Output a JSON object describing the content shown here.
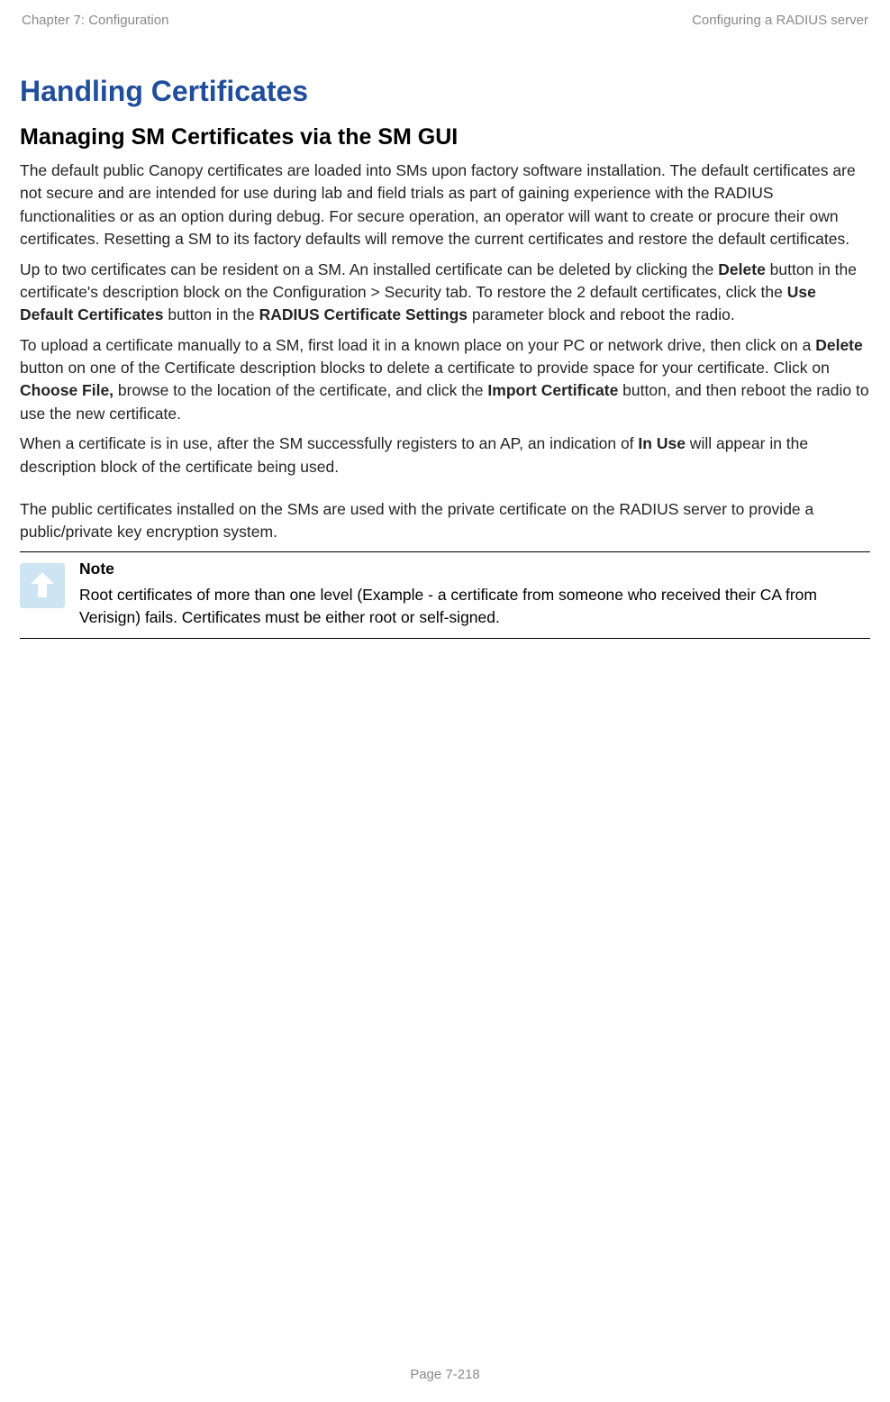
{
  "header": {
    "left": "Chapter 7:  Configuration",
    "right": "Configuring a RADIUS server"
  },
  "h1": "Handling Certificates",
  "h2": "Managing SM Certificates via the SM GUI",
  "p1": "The default public Canopy certificates are loaded into SMs upon factory software installation. The default certificates are not secure and are intended for use during lab and field trials as part of gaining experience with the RADIUS functionalities or as an option during debug. For secure operation, an operator will want to create or procure their own certificates. Resetting a SM to its factory defaults will remove the current certificates and restore the default certificates.",
  "p2_part1": "Up to two certificates can be resident on a SM. An installed certificate can be deleted by clicking the ",
  "p2_bold1": "Delete",
  "p2_part2": " button in the certificate's description block on the Configuration > Security tab. To restore the 2 default certificates, click the ",
  "p2_bold2": "Use Default Certificates",
  "p2_part3": " button in the ",
  "p2_bold3": "RADIUS Certificate Settings",
  "p2_part4": " parameter block and reboot the radio.",
  "p3_part1": "To upload a certificate manually to a SM, first load it in a known place on your PC or network drive, then click on a ",
  "p3_bold1": "Delete",
  "p3_part2": " button on one of the Certificate description blocks to delete a certificate to provide space for your certificate. Click on ",
  "p3_bold2": "Choose File,",
  "p3_part3": " browse to the location of the certificate, and click the ",
  "p3_bold3": "Import Certificate",
  "p3_part4": " button, and then reboot the radio to use the new certificate.",
  "p4_part1": "When a certificate is in use, after the SM successfully registers to an AP, an indication of ",
  "p4_bold1": "In Use",
  "p4_part2": " will appear in the description block of the certificate being used.",
  "p5": "The public certificates installed on the SMs are used with the private certificate on the RADIUS server to provide a public/private key encryption system.",
  "note": {
    "title": "Note",
    "body": "Root certificates of more than one level (Example - a certificate from someone who received their CA from Verisign) fails. Certificates must be either root or self-signed."
  },
  "footer": "Page 7-218"
}
